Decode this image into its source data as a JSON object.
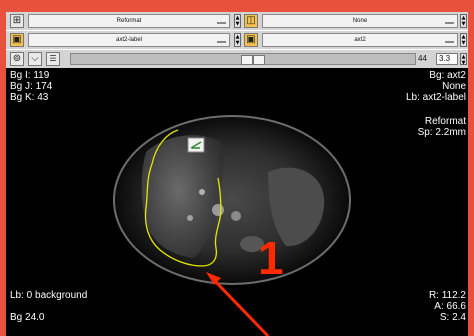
{
  "toolbar": {
    "row1": {
      "left_menu": "Reformat",
      "right_menu": "None"
    },
    "row2": {
      "left_menu": "axt2-label",
      "right_menu": "axt2"
    },
    "slider": {
      "value": "44",
      "opacity": "3.3"
    }
  },
  "overlay": {
    "top_left": [
      "Bg I: 119",
      "Bg J: 174",
      "Bg K: 43"
    ],
    "top_right": [
      "Bg: axt2",
      "None",
      "Lb: axt2-label"
    ],
    "mid_right": [
      "Reformat",
      "Sp: 2.2mm"
    ],
    "bottom_left": [
      "Lb: 0 background",
      "Bg 24.0"
    ],
    "bottom_right": [
      "R: 112.2",
      "A: 66.6",
      "S: 2.4"
    ]
  },
  "annotation": {
    "label": "1",
    "color": "#ff2a00"
  },
  "colors": {
    "frame": "#e8523c",
    "segmentation": "#e6e600"
  }
}
